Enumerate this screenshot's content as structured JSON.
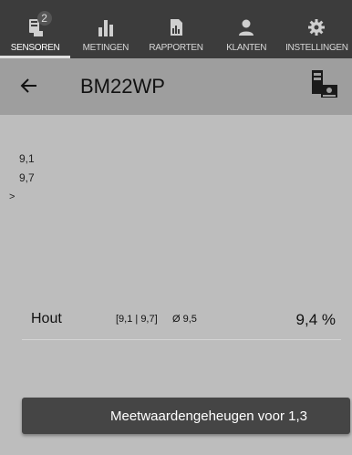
{
  "nav": {
    "items": [
      {
        "label": "SENSOREN",
        "icon": "sensor-icon",
        "badge": "2",
        "active": true
      },
      {
        "label": "METINGEN",
        "icon": "bar-chart-icon"
      },
      {
        "label": "RAPPORTEN",
        "icon": "report-icon"
      },
      {
        "label": "KLANTEN",
        "icon": "customers-icon"
      },
      {
        "label": "INSTELLINGEN",
        "icon": "gear-icon"
      }
    ]
  },
  "header": {
    "title": "BM22WP",
    "back_icon": "arrow-left-icon",
    "rec_icon": "rec-device-icon"
  },
  "readings": {
    "values": [
      "9,1",
      "9,7"
    ],
    "caret": ">"
  },
  "measurement": {
    "name": "Hout",
    "range": "[9,1 | 9,7]",
    "average": "Ø 9,5",
    "value": "9,4 %"
  },
  "footer": {
    "button_label": "Meetwaardengeheugen voor 1,3"
  },
  "colors": {
    "nav_bg": "#3c3c3c",
    "subheader_bg": "#9e9e9e",
    "body_bg": "#bdbdbd",
    "button_bg": "#454545"
  }
}
